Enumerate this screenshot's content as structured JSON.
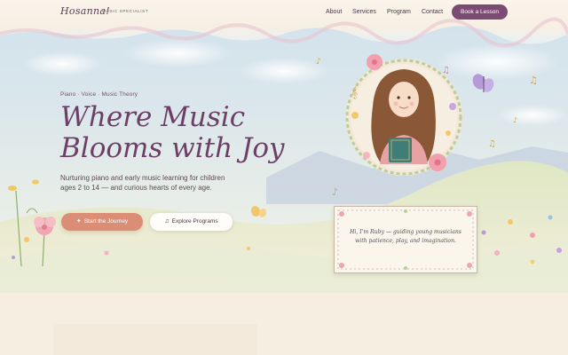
{
  "brand": {
    "name": "Hosanna!",
    "tagline": "MUSIC SPECIALIST"
  },
  "nav": {
    "links": [
      "About",
      "Services",
      "Program",
      "Contact"
    ],
    "cta": "Book a Lesson"
  },
  "hero": {
    "eyebrow": "Piano · Voice · Music Theory",
    "title_line1": "Where Music",
    "title_line2": "Blooms with Joy",
    "lead": "Nurturing piano and early music learning for children ages 2 to 14 — and curious hearts of every age.",
    "primary_button": "Start the Journey",
    "secondary_button": "Explore Programs"
  },
  "card": {
    "text": "Hi, I'm Ruby — guiding young musicians with patience, play, and imagination."
  },
  "icons": {
    "primary": "sparkle-icon",
    "secondary": "music-note-icon"
  },
  "colors": {
    "accent": "#7b4b73",
    "primary_button": "#dc8d76",
    "title": "#6d3f66",
    "background": "#f6eee1"
  }
}
